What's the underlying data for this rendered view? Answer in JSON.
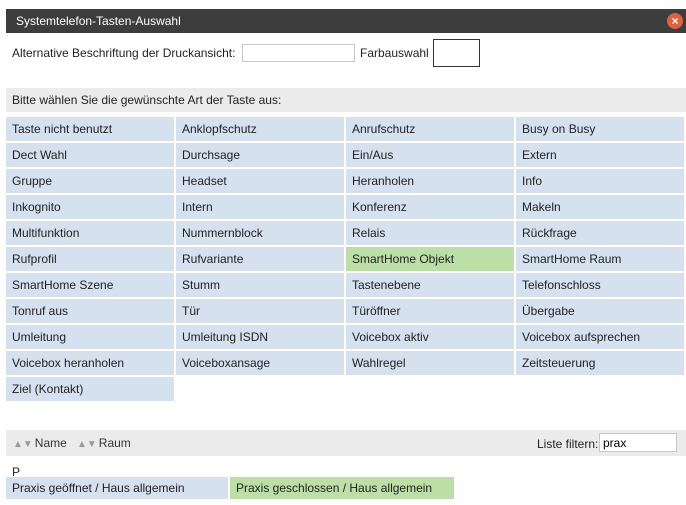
{
  "dialog": {
    "title": "Systemtelefon-Tasten-Auswahl",
    "close_glyph": "×"
  },
  "print_label": {
    "label": "Alternative Beschriftung der Druckansicht:",
    "value": ""
  },
  "color": {
    "label": "Farbauswahl",
    "value": "#ffffff"
  },
  "hint": "Bitte wählen Sie die gewünschte Art der Taste aus:",
  "key_types": [
    [
      "Taste nicht benutzt",
      "Anklopfschutz",
      "Anrufschutz",
      "Busy on Busy"
    ],
    [
      "Dect Wahl",
      "Durchsage",
      "Ein/Aus",
      "Extern"
    ],
    [
      "Gruppe",
      "Headset",
      "Heranholen",
      "Info"
    ],
    [
      "Inkognito",
      "Intern",
      "Konferenz",
      "Makeln"
    ],
    [
      "Multifunktion",
      "Nummernblock",
      "Relais",
      "Rückfrage"
    ],
    [
      "Rufprofil",
      "Rufvariante",
      "SmartHome Objekt",
      "SmartHome Raum"
    ],
    [
      "SmartHome Szene",
      "Stumm",
      "Tastenebene",
      "Telefonschloss"
    ],
    [
      "Tonruf aus",
      "Tür",
      "Türöffner",
      "Übergabe"
    ],
    [
      "Umleitung",
      "Umleitung ISDN",
      "Voicebox aktiv",
      "Voicebox aufsprechen"
    ],
    [
      "Voicebox heranholen",
      "Voiceboxansage",
      "Wahlregel",
      "Zeitsteuerung"
    ],
    [
      "Ziel (Kontakt)"
    ]
  ],
  "selected_key_type": "SmartHome Objekt",
  "list": {
    "sort_name": "Name",
    "sort_room": "Raum",
    "filter_label": "Liste filtern:",
    "filter_value": "prax",
    "group_letter": "P",
    "items": [
      "Praxis geöffnet / Haus allgemein",
      "Praxis geschlossen / Haus allgemein"
    ],
    "selected_item": "Praxis geschlossen / Haus allgemein"
  },
  "colors": {
    "cell": "#d5e1ee",
    "selected": "#bcdfa6",
    "titlebar": "#3d3d3d",
    "close": "#e0623c"
  }
}
